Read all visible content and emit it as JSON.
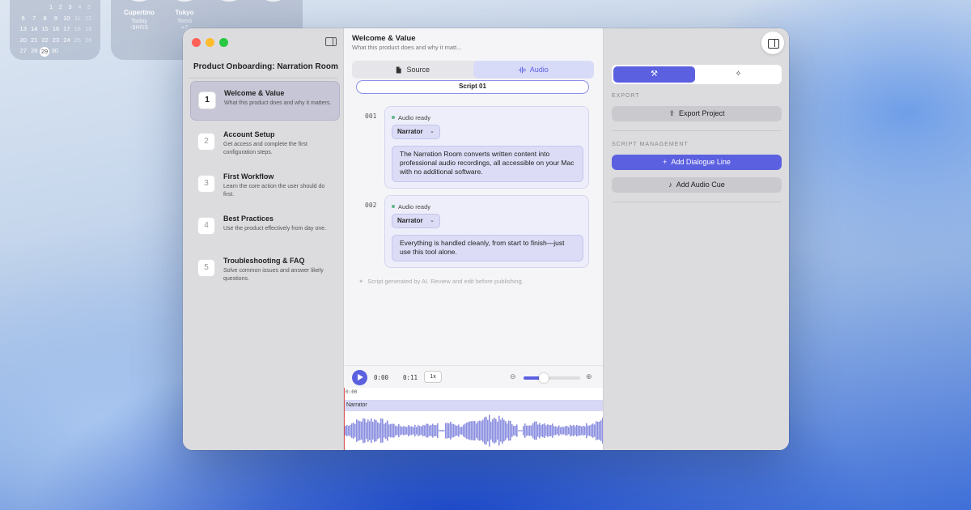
{
  "desktop": {
    "calendar_rows": [
      [
        "",
        "",
        "",
        "1",
        "2",
        "3",
        "4",
        "5"
      ],
      [
        "6",
        "7",
        "8",
        "9",
        "10",
        "11",
        "12"
      ],
      [
        "13",
        "14",
        "15",
        "16",
        "17",
        "18",
        "19"
      ],
      [
        "20",
        "21",
        "22",
        "23",
        "24",
        "25",
        "26"
      ],
      [
        "27",
        "28",
        "29",
        "30"
      ]
    ],
    "calendar_today": "29",
    "clocks": [
      {
        "city": "Cupertino",
        "line1": "Today",
        "line2": "-9HRS"
      },
      {
        "city": "Tokyo",
        "line1": "Tomo",
        "line2": "+7"
      }
    ]
  },
  "window": {
    "sidebar": {
      "project_title": "Product Onboarding: Narration Room",
      "steps": [
        {
          "num": "1",
          "title": "Welcome & Value",
          "desc": "What this product does and why it matters."
        },
        {
          "num": "2",
          "title": "Account Setup",
          "desc": "Get access and complete the first configuration steps."
        },
        {
          "num": "3",
          "title": "First Workflow",
          "desc": "Learn the core action the user should do first."
        },
        {
          "num": "4",
          "title": "Best Practices",
          "desc": "Use the product effectively from day one."
        },
        {
          "num": "5",
          "title": "Troubleshooting & FAQ",
          "desc": "Solve common issues and answer likely questions."
        }
      ],
      "active_step": 0
    },
    "main": {
      "title": "Welcome & Value",
      "subtitle": "What this product does and why it matt...",
      "tabs": [
        {
          "label": "Source",
          "icon": "document-icon"
        },
        {
          "label": "Audio",
          "icon": "waveform-icon"
        }
      ],
      "active_tab": "Audio",
      "script_name": "Script 01",
      "lines": [
        {
          "num": "001",
          "status": "Audio ready",
          "speaker": "Narrator",
          "text": "The Narration Room converts written content into professional audio recordings, all accessible on your Mac with no additional software."
        },
        {
          "num": "002",
          "status": "Audio ready",
          "speaker": "Narrator",
          "text": "Everything is handled cleanly, from start to finish—just use this tool alone."
        }
      ],
      "ai_note": "Script generated by AI. Review and edit before publishing.",
      "player": {
        "current_time": "0:00",
        "duration": "0:11",
        "speed": "1x",
        "zoom_level": 0.35,
        "ruler_start": "0:00",
        "track_name": "Narrator"
      }
    },
    "inspector": {
      "tabs": [
        {
          "icon": "tools-icon"
        },
        {
          "icon": "sparkle-icon"
        }
      ],
      "export_label": "EXPORT",
      "export_button": "Export Project",
      "script_mgmt_label": "SCRIPT MANAGEMENT",
      "add_line_button": "Add Dialogue Line",
      "add_cue_button": "Add Audio Cue"
    }
  },
  "colors": {
    "accent": "#5b60e0",
    "status_ready": "#5db88a",
    "playhead": "#e05050"
  }
}
